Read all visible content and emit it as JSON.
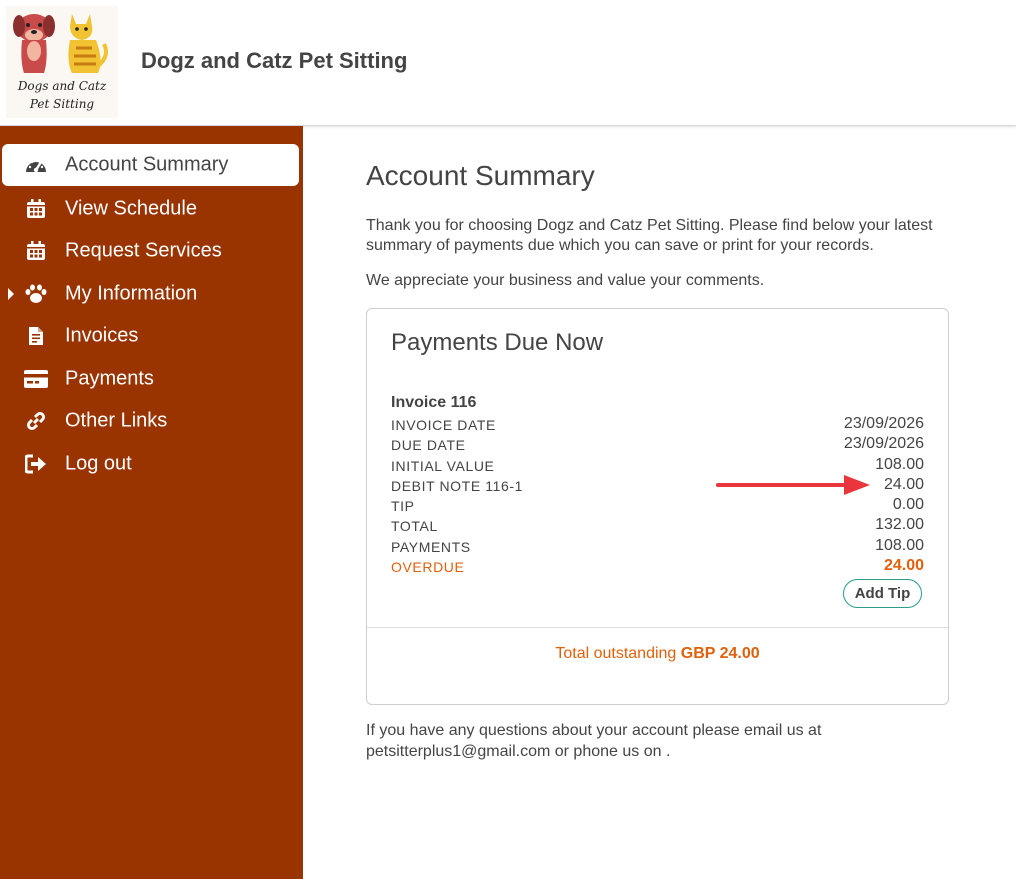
{
  "brand": {
    "name": "Dogz and Catz Pet Sitting",
    "logo_line1": "Dogs and Catz",
    "logo_line2": "Pet Sitting"
  },
  "colors": {
    "sidebar": "#993300",
    "accent_overdue": "#e0600b",
    "button_border": "#2a9d8f",
    "annotation_arrow": "#e8363c"
  },
  "sidebar": {
    "items": [
      {
        "label": "Account Summary",
        "icon": "dashboard-icon",
        "active": true
      },
      {
        "label": "View Schedule",
        "icon": "calendar-icon"
      },
      {
        "label": "Request Services",
        "icon": "calendar-icon"
      },
      {
        "label": "My Information",
        "icon": "paw-icon",
        "expandable": true
      },
      {
        "label": "Invoices",
        "icon": "document-icon"
      },
      {
        "label": "Payments",
        "icon": "credit-card-icon"
      },
      {
        "label": "Other Links",
        "icon": "link-icon"
      },
      {
        "label": "Log out",
        "icon": "sign-out-icon"
      }
    ]
  },
  "main": {
    "title": "Account Summary",
    "intro": "Thank you for choosing Dogz and Catz Pet Sitting. Please find below your latest summary of payments due which you can save or print for your records.",
    "appreciate": "We appreciate your business and value your comments.",
    "card": {
      "title": "Payments Due Now",
      "invoice_title": "Invoice 116",
      "rows": [
        {
          "label": "INVOICE DATE",
          "value": "23/09/2026"
        },
        {
          "label": "DUE DATE",
          "value": "23/09/2026"
        },
        {
          "label": "INITIAL VALUE",
          "value": "108.00"
        },
        {
          "label": "DEBIT NOTE 116-1",
          "value": "24.00"
        },
        {
          "label": "TIP",
          "value": "0.00"
        },
        {
          "label": "TOTAL",
          "value": "132.00"
        },
        {
          "label": "PAYMENTS",
          "value": "108.00"
        },
        {
          "label": "OVERDUE",
          "value": "24.00"
        }
      ],
      "add_tip_label": "Add Tip",
      "total_outstanding_label": "Total outstanding",
      "total_outstanding_value": "GBP 24.00"
    },
    "footer_note": "If you have any questions about your account please email us at petsitterplus1@gmail.com or phone us on ."
  }
}
